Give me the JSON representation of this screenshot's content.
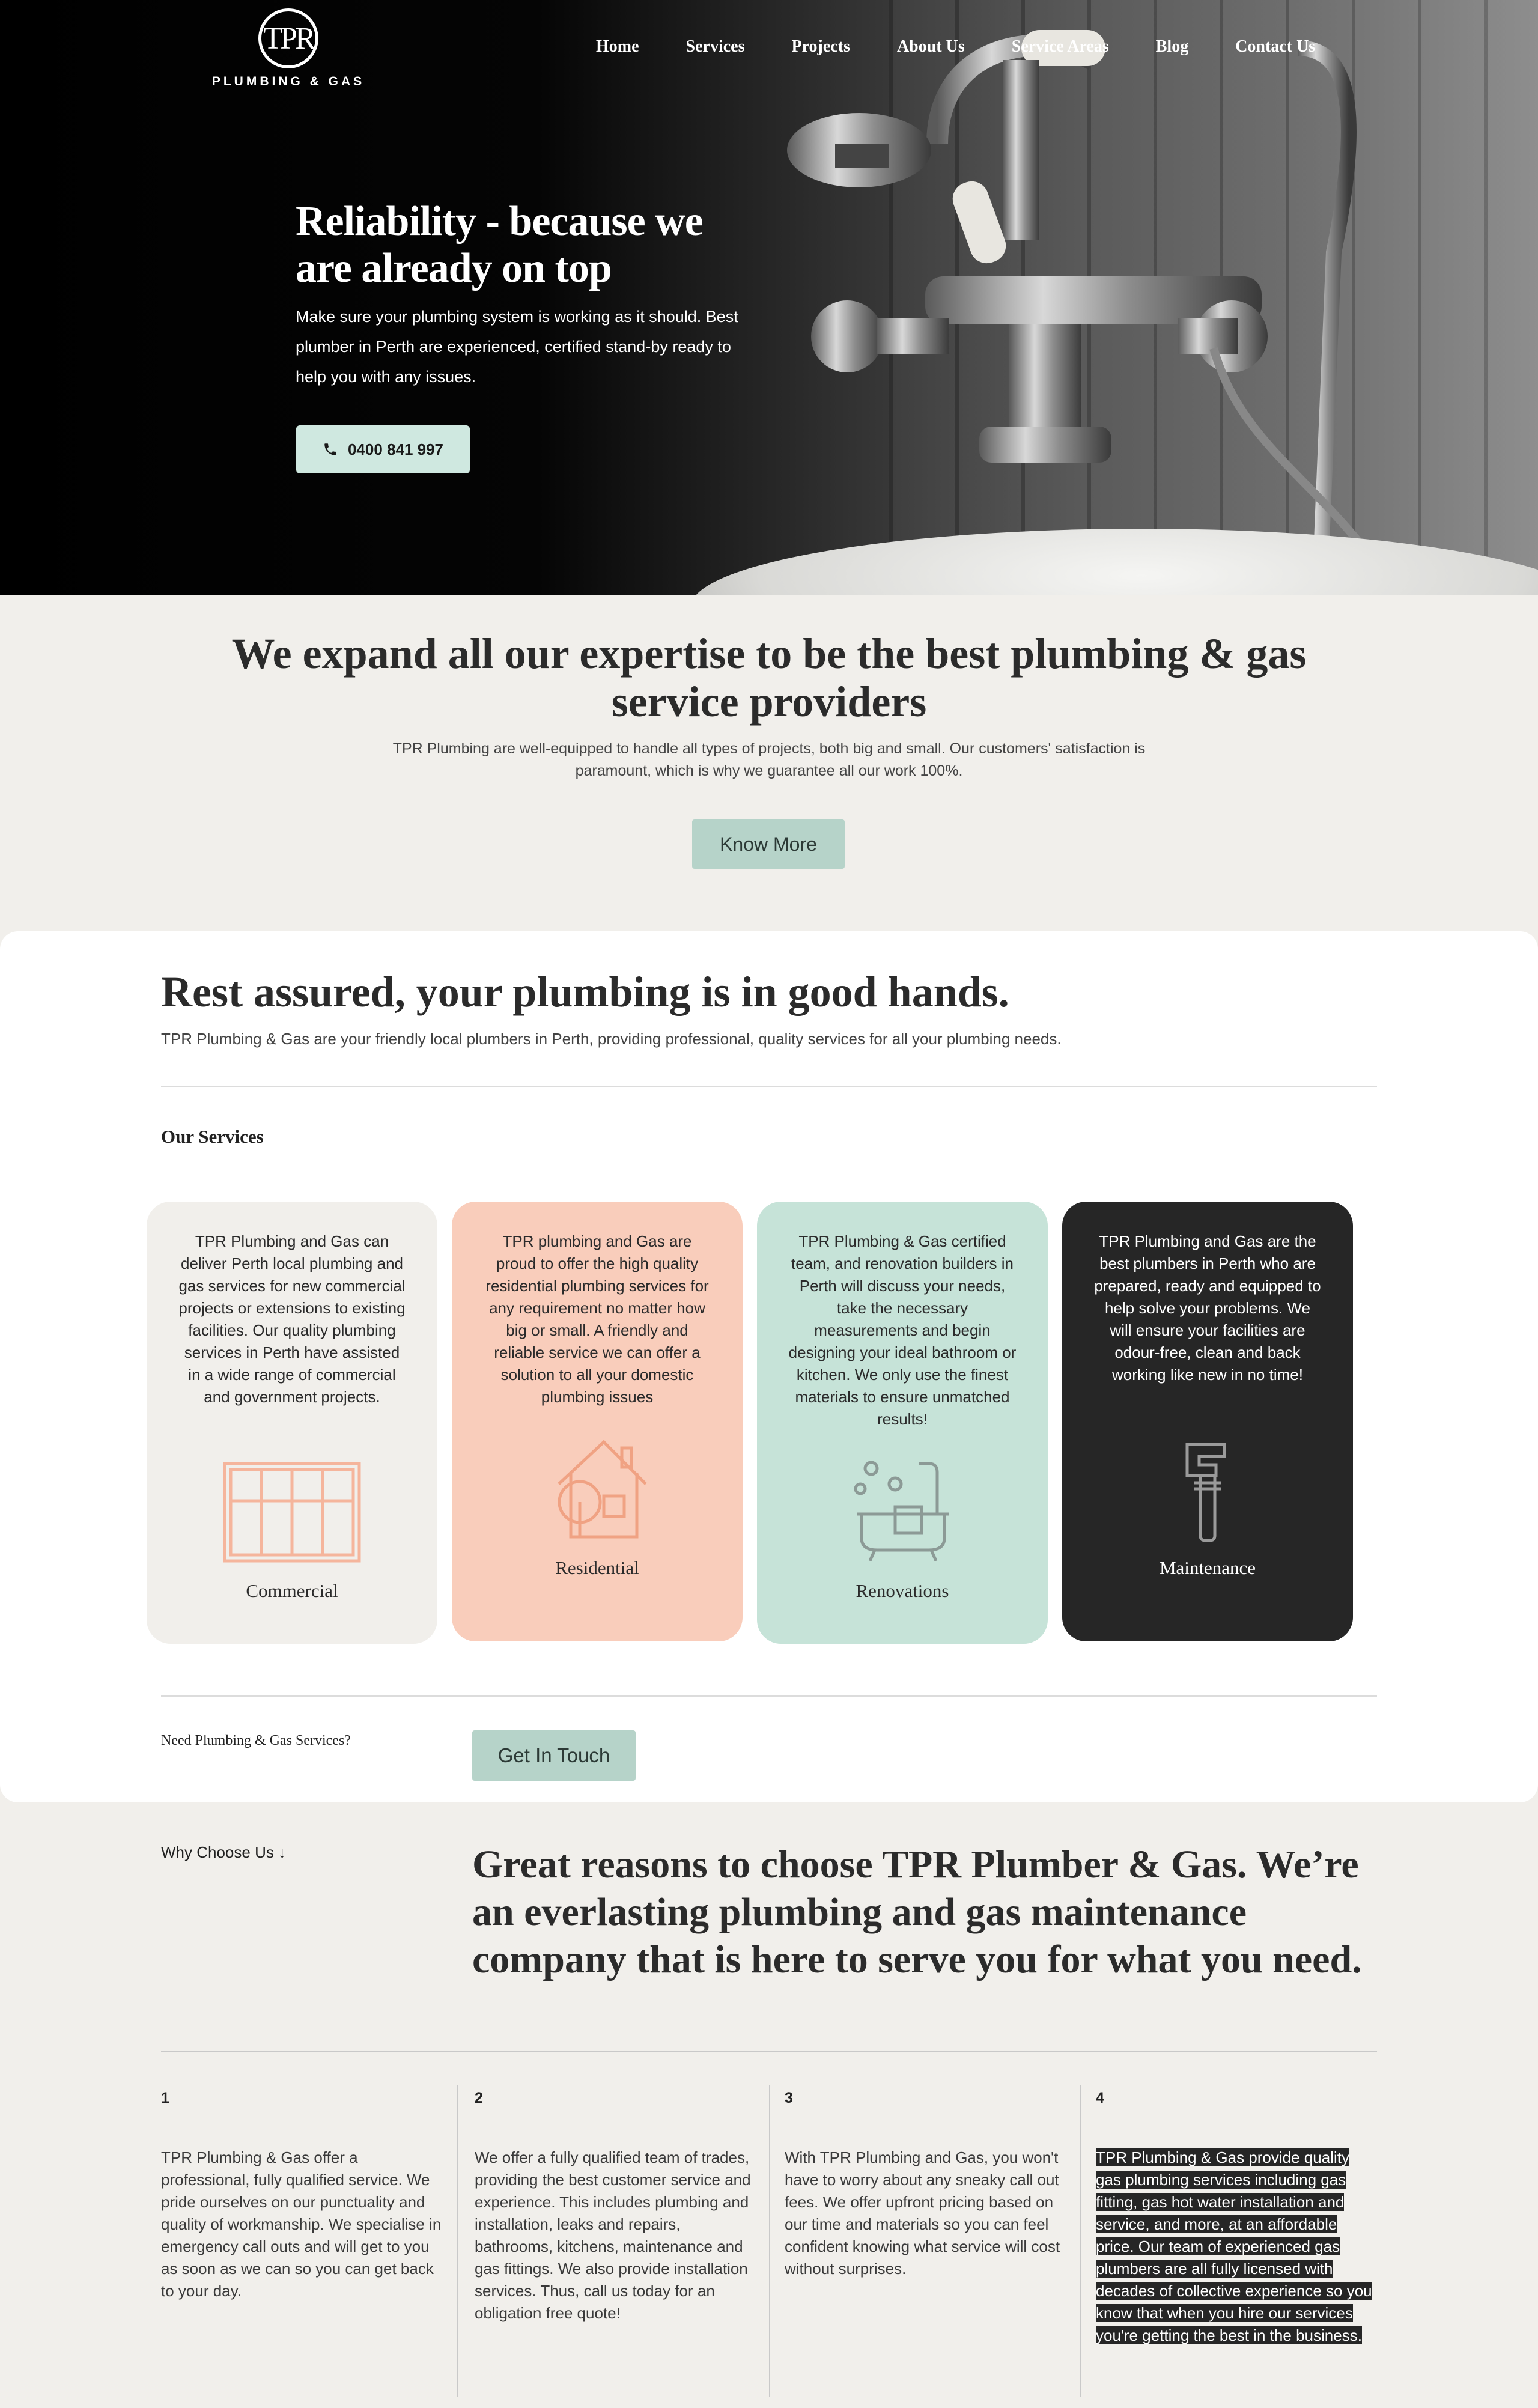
{
  "brand": {
    "monogram": "TPR",
    "name": "PLUMBING & GAS"
  },
  "nav": [
    "Home",
    "Services",
    "Projects",
    "About Us",
    "Service Areas",
    "Blog",
    "Contact Us"
  ],
  "hero": {
    "title": "Reliability - because we are already on top",
    "subtitle": "Make sure your plumbing system is working as it should. Best plumber in Perth are experienced, certified stand-by ready to help you with any issues.",
    "phone": "0400 841 997"
  },
  "intro": {
    "title": "We expand all our expertise to be the best plumbing & gas service providers",
    "text": "TPR Plumbing are well-equipped to handle all types of projects, both big and small. Our customers' satisfaction is paramount, which is why we guarantee all our work 100%.",
    "button": "Know More"
  },
  "services_section": {
    "title": "Rest assured, your plumbing is in good hands.",
    "text": "TPR Plumbing & Gas are your friendly local plumbers in Perth, providing professional, quality services for all your plumbing needs.",
    "heading": "Our Services",
    "cards": [
      {
        "label": "Commercial",
        "icon": "window-grid-icon",
        "text": "TPR Plumbing and Gas can deliver Perth local plumbing and gas services for new commercial projects or extensions to existing facilities. Our quality plumbing services in Perth have assisted in a wide range of commercial and government projects."
      },
      {
        "label": "Residential",
        "icon": "house-tree-icon",
        "text": "TPR plumbing and Gas are proud to offer the high quality residential plumbing services for any requirement no matter how big or small. A friendly and reliable service we can offer a solution to all your domestic plumbing issues"
      },
      {
        "label": "Renovations",
        "icon": "bathtub-icon",
        "text": "TPR Plumbing & Gas certified team, and renovation builders in Perth will discuss your needs, take the necessary measurements and begin designing your ideal bathroom or kitchen. We only use the finest materials to ensure unmatched results!"
      },
      {
        "label": "Maintenance",
        "icon": "pipe-wrench-icon",
        "text": "TPR Plumbing and Gas are the best plumbers in Perth who are prepared, ready and equipped to help solve your problems. We will ensure your facilities are odour-free, clean and back working like new in no time!"
      }
    ],
    "cta_text": "Need Plumbing & Gas Services?",
    "cta_button": "Get In Touch"
  },
  "why": {
    "label": "Why Choose Us ↓",
    "title": "Great reasons to choose TPR Plumber & Gas. We’re an everlasting plumbing and gas maintenance company that is here to serve you for what you need.",
    "reasons": [
      {
        "num": "1",
        "text": "TPR Plumbing & Gas offer a professional, fully qualified service. We pride ourselves on our punctuality and quality of workmanship. We specialise in emergency call outs and will get to you as soon as we can so you can get back to your day."
      },
      {
        "num": "2",
        "text": "We offer a fully qualified team of trades, providing the best customer service and experience. This includes plumbing and installation, leaks and repairs, bathrooms, kitchens, maintenance and gas fittings. We also provide installation services. Thus, call us today for an obligation free quote!"
      },
      {
        "num": "3",
        "text": "With TPR Plumbing and Gas, you won't have to worry about any sneaky call out fees. We offer upfront pricing based on our time and materials so you can feel confident knowing what service will cost without surprises."
      },
      {
        "num": "4",
        "text": "TPR Plumbing & Gas provide quality gas plumbing services including gas fitting, gas hot water installation and service, and more, at an affordable price. Our team of experienced gas plumbers are all fully licensed with decades of collective experience so you know that when you hire our services you're getting the best in the business."
      }
    ]
  }
}
